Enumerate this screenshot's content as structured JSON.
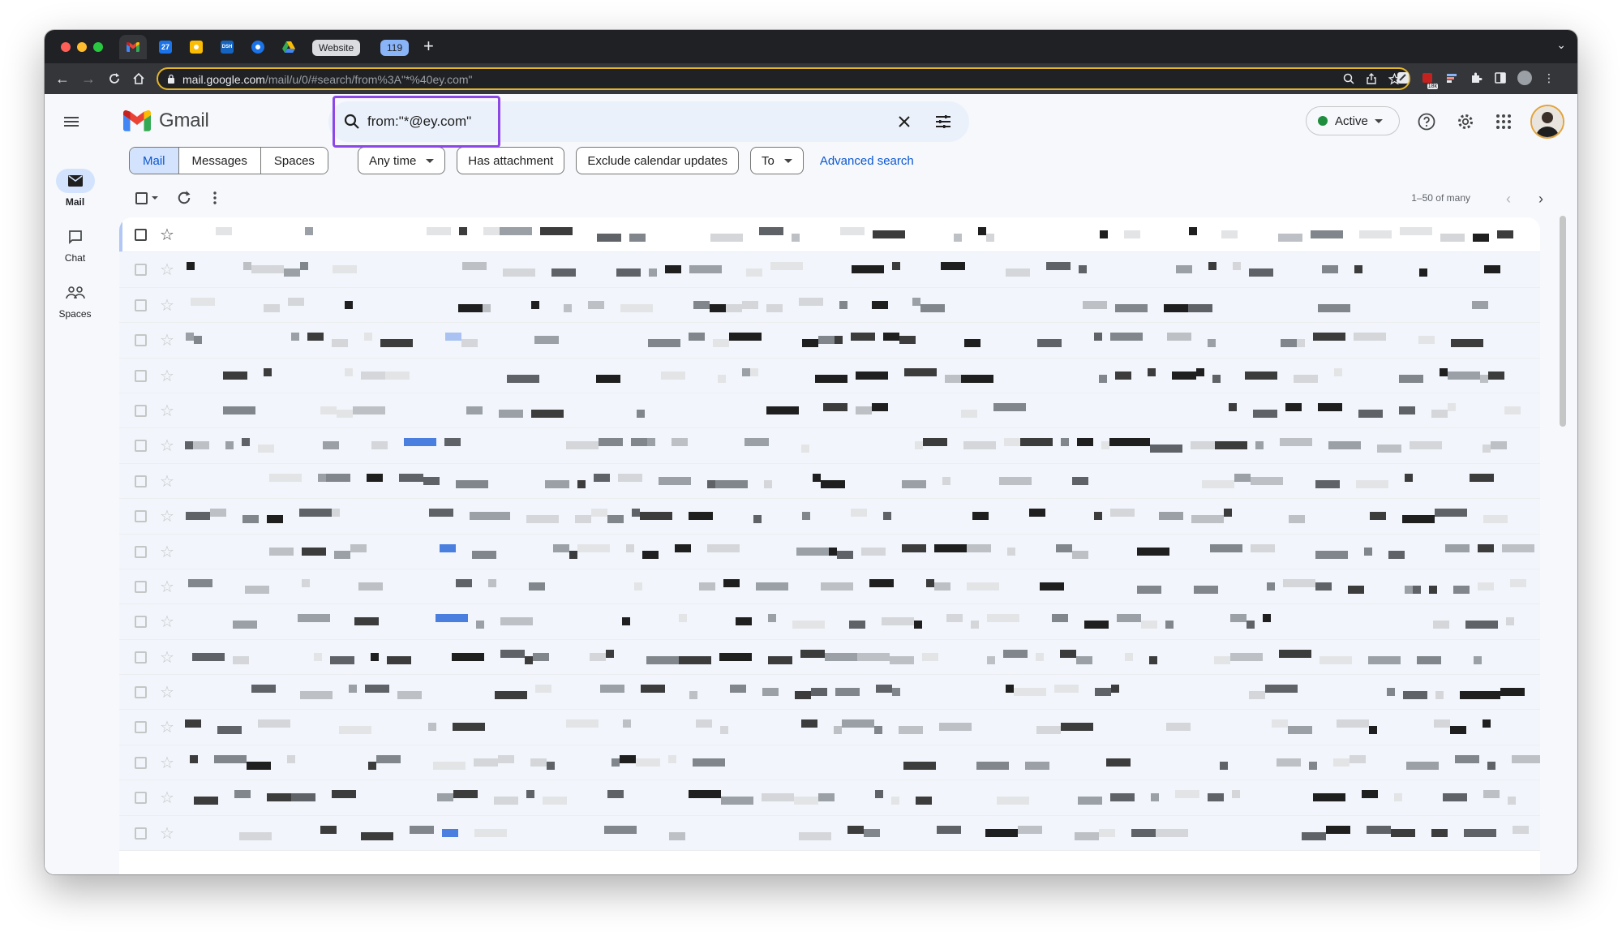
{
  "browser": {
    "tabs": [
      {
        "name": "gmail-tab",
        "glyph": "M",
        "color": "#ea4335",
        "active": true
      },
      {
        "name": "calendar-tab",
        "glyph": "27",
        "color": "#1a73e8"
      },
      {
        "name": "keep-tab",
        "glyph": "",
        "color": "#fbbc04"
      },
      {
        "name": "dashboard-tab",
        "glyph": "DSH",
        "color": "#1565c0"
      },
      {
        "name": "contacts-tab",
        "glyph": "",
        "color": "#1a73e8"
      },
      {
        "name": "drive-tab",
        "glyph": "",
        "color": "#34a853"
      }
    ],
    "tab_groups": [
      {
        "label": "Website",
        "bg": "#dadce0",
        "fg": "#202124"
      },
      {
        "label": "119",
        "bg": "#8ab4f8",
        "fg": "#202124"
      }
    ],
    "url_domain": "mail.google.com",
    "url_path": "/mail/u/0/#search/from%3A\"*%40ey.com\"",
    "ext_badge": "18k"
  },
  "gmail": {
    "app_name": "Gmail",
    "rail": [
      {
        "label": "Mail",
        "icon": "mail-icon",
        "selected": true
      },
      {
        "label": "Chat",
        "icon": "chat-icon",
        "selected": false
      },
      {
        "label": "Spaces",
        "icon": "spaces-icon",
        "selected": false
      }
    ],
    "search": {
      "query": "from:\"*@ey.com\""
    },
    "status": {
      "label": "Active",
      "color": "#1e8e3e"
    },
    "filters": {
      "segments": [
        "Mail",
        "Messages",
        "Spaces"
      ],
      "selected_segment": "Mail",
      "chips": [
        {
          "label": "Any time",
          "dropdown": true
        },
        {
          "label": "Has attachment",
          "dropdown": false
        },
        {
          "label": "Exclude calendar updates",
          "dropdown": false
        },
        {
          "label": "To",
          "dropdown": true
        }
      ],
      "advanced_link": "Advanced search"
    },
    "pagination": "1–50 of many",
    "rows_count_visible": 18,
    "accent": "#0b57d0"
  }
}
